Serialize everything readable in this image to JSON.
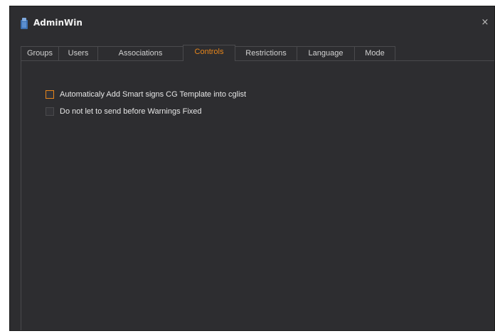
{
  "window": {
    "title": "AdminWin",
    "close_glyph": "×",
    "app_icon": "app-icon",
    "accent_color": "#e8861b",
    "background_color": "#2d2d30"
  },
  "tabs": [
    {
      "label": "Groups",
      "active": false
    },
    {
      "label": "Users",
      "active": false
    },
    {
      "label": "Associations",
      "active": false
    },
    {
      "label": "Controls",
      "active": true
    },
    {
      "label": "Restrictions",
      "active": false
    },
    {
      "label": "Language",
      "active": false
    },
    {
      "label": "Mode",
      "active": false
    }
  ],
  "controls": {
    "options": [
      {
        "label": "Automaticaly Add Smart signs CG Template into cglist",
        "checked": false,
        "focused": true
      },
      {
        "label": "Do not let to send before Warnings Fixed",
        "checked": false,
        "focused": false
      }
    ]
  }
}
